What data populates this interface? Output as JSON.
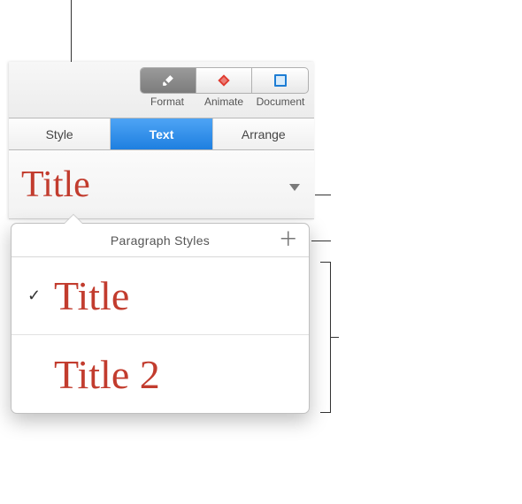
{
  "toolbar": {
    "format": "Format",
    "animate": "Animate",
    "document": "Document"
  },
  "tabs": {
    "style": "Style",
    "text": "Text",
    "arrange": "Arrange"
  },
  "current_style": "Title",
  "popover": {
    "heading": "Paragraph Styles",
    "items": [
      {
        "label": "Title",
        "selected": true
      },
      {
        "label": "Title 2",
        "selected": false
      }
    ]
  }
}
